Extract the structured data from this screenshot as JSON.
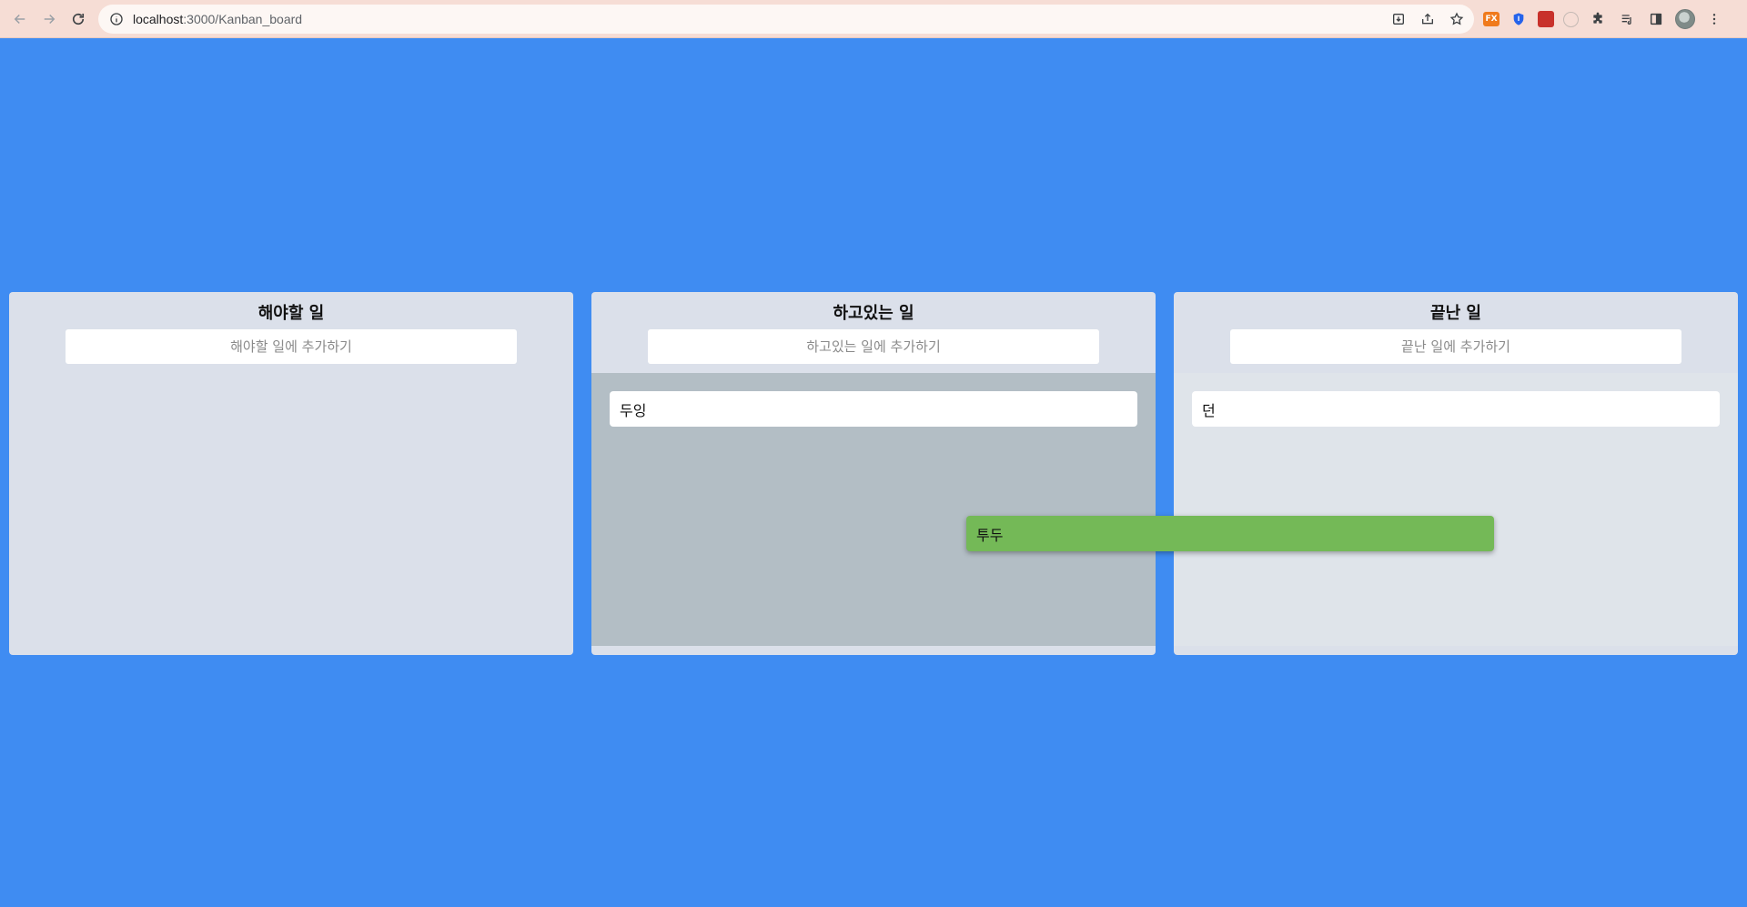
{
  "browser": {
    "url_host": "localhost",
    "url_path": ":3000/Kanban_board",
    "extensions": [
      "fx-extension-icon",
      "shield-extension-icon",
      "red-extension-icon",
      "compass-extension-icon",
      "puzzle-icon",
      "reading-list-icon",
      "side-panel-icon"
    ],
    "fx_label": "FX"
  },
  "board": {
    "columns": [
      {
        "title": "해야할 일",
        "placeholder": "해야할 일에 추가하기",
        "cards": []
      },
      {
        "title": "하고있는 일",
        "placeholder": "하고있는 일에 추가하기",
        "cards": [
          "두잉"
        ]
      },
      {
        "title": "끝난 일",
        "placeholder": "끝난 일에 추가하기",
        "cards": [
          "던"
        ]
      }
    ],
    "dragging_card": "투두"
  },
  "colors": {
    "background": "#3f8cf2",
    "column": "#dbe0ea",
    "dropzone_active": "#b3bec5",
    "dragging_card": "#74b957"
  }
}
